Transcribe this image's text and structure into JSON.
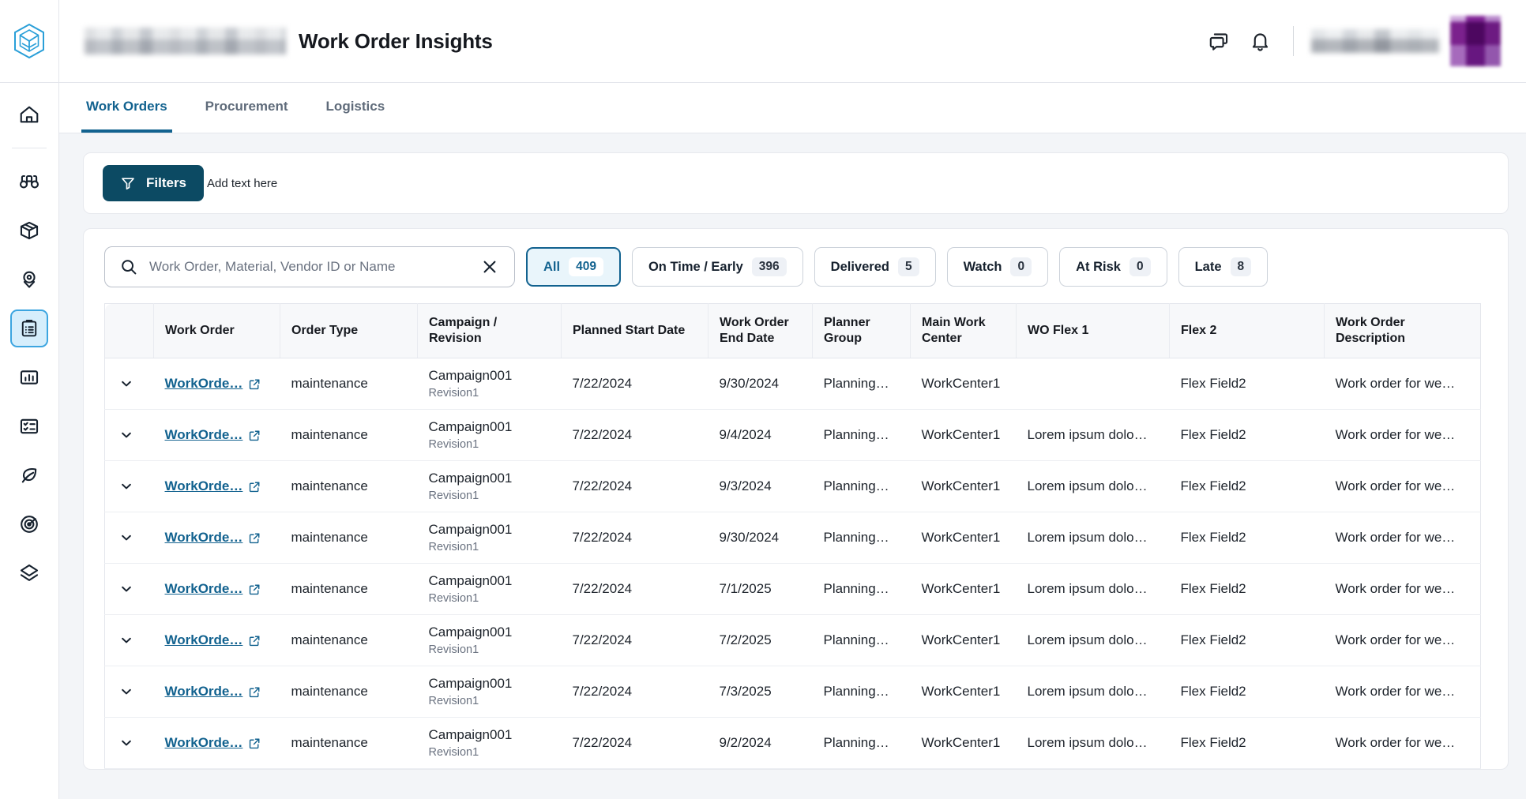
{
  "app": {
    "title": "Work Order Insights",
    "logo_icon": "hexagon-cube-logo",
    "org_name_redacted": "",
    "user_name_redacted": ""
  },
  "topbar": {
    "chat_icon": "chat-bubbles-icon",
    "notifications_icon": "bell-icon",
    "avatar_label": ""
  },
  "sidebar": {
    "items": [
      {
        "name": "home",
        "icon": "home-icon",
        "active": false
      },
      {
        "name": "discover",
        "icon": "binoculars-icon",
        "active": false
      },
      {
        "name": "inventory",
        "icon": "box-icon",
        "active": false
      },
      {
        "name": "locations",
        "icon": "map-pin-icon",
        "active": false
      },
      {
        "name": "work-orders",
        "icon": "clipboard-list-icon",
        "active": true
      },
      {
        "name": "analytics",
        "icon": "bar-chart-icon",
        "active": false
      },
      {
        "name": "tasks",
        "icon": "checklist-icon",
        "active": false
      },
      {
        "name": "sustainability",
        "icon": "leaf-icon",
        "active": false
      },
      {
        "name": "targets",
        "icon": "radar-target-icon",
        "active": false
      },
      {
        "name": "layers",
        "icon": "layers-diamond-icon",
        "active": false
      }
    ]
  },
  "tabs": [
    {
      "label": "Work Orders",
      "active": true
    },
    {
      "label": "Procurement",
      "active": false
    },
    {
      "label": "Logistics",
      "active": false
    }
  ],
  "filters": {
    "button_label": "Filters",
    "filter_icon": "funnel-icon",
    "hint_text": "Add text here"
  },
  "search": {
    "placeholder": "Work Order, Material, Vendor ID or Name",
    "value": "",
    "search_icon": "search-icon",
    "clear_icon": "close-x-icon"
  },
  "status_chips": [
    {
      "label": "All",
      "count": "409",
      "active": true
    },
    {
      "label": "On Time / Early",
      "count": "396",
      "active": false
    },
    {
      "label": "Delivered",
      "count": "5",
      "active": false
    },
    {
      "label": "Watch",
      "count": "0",
      "active": false
    },
    {
      "label": "At Risk",
      "count": "0",
      "active": false
    },
    {
      "label": "Late",
      "count": "8",
      "active": false
    }
  ],
  "table": {
    "columns": [
      "",
      "Work Order",
      "Order Type",
      "Campaign / Revision",
      "Planned Start Date",
      "Work Order End Date",
      "Planner Group",
      "Main Work Center",
      "WO Flex 1",
      "Flex 2",
      "Work Order Description"
    ],
    "expand_icon": "chevron-down-icon",
    "external_link_icon": "external-link-icon",
    "rows": [
      {
        "work_order": "WorkOrde…",
        "order_type": "maintenance",
        "campaign": "Campaign001",
        "revision": "Revision1",
        "planned_start": "7/22/2024",
        "end_date": "9/30/2024",
        "planner_group": "PlanningG…",
        "main_work_center": "WorkCenter1",
        "wo_flex_1": "",
        "flex_2": "Flex Field2",
        "description": "Work order for we…"
      },
      {
        "work_order": "WorkOrde…",
        "order_type": "maintenance",
        "campaign": "Campaign001",
        "revision": "Revision1",
        "planned_start": "7/22/2024",
        "end_date": "9/4/2024",
        "planner_group": "PlanningG…",
        "main_work_center": "WorkCenter1",
        "wo_flex_1": "Lorem ipsum dolo…",
        "flex_2": "Flex Field2",
        "description": "Work order for we…"
      },
      {
        "work_order": "WorkOrde…",
        "order_type": "maintenance",
        "campaign": "Campaign001",
        "revision": "Revision1",
        "planned_start": "7/22/2024",
        "end_date": "9/3/2024",
        "planner_group": "PlanningG…",
        "main_work_center": "WorkCenter1",
        "wo_flex_1": "Lorem ipsum dolo…",
        "flex_2": "Flex Field2",
        "description": "Work order for we…"
      },
      {
        "work_order": "WorkOrde…",
        "order_type": "maintenance",
        "campaign": "Campaign001",
        "revision": "Revision1",
        "planned_start": "7/22/2024",
        "end_date": "9/30/2024",
        "planner_group": "PlanningG…",
        "main_work_center": "WorkCenter1",
        "wo_flex_1": "Lorem ipsum dolo…",
        "flex_2": "Flex Field2",
        "description": "Work order for we…"
      },
      {
        "work_order": "WorkOrde…",
        "order_type": "maintenance",
        "campaign": "Campaign001",
        "revision": "Revision1",
        "planned_start": "7/22/2024",
        "end_date": "7/1/2025",
        "planner_group": "PlanningG…",
        "main_work_center": "WorkCenter1",
        "wo_flex_1": "Lorem ipsum dolo…",
        "flex_2": "Flex Field2",
        "description": "Work order for we…"
      },
      {
        "work_order": "WorkOrde…",
        "order_type": "maintenance",
        "campaign": "Campaign001",
        "revision": "Revision1",
        "planned_start": "7/22/2024",
        "end_date": "7/2/2025",
        "planner_group": "PlanningG…",
        "main_work_center": "WorkCenter1",
        "wo_flex_1": "Lorem ipsum dolo…",
        "flex_2": "Flex Field2",
        "description": "Work order for we…"
      },
      {
        "work_order": "WorkOrde…",
        "order_type": "maintenance",
        "campaign": "Campaign001",
        "revision": "Revision1",
        "planned_start": "7/22/2024",
        "end_date": "7/3/2025",
        "planner_group": "PlanningG…",
        "main_work_center": "WorkCenter1",
        "wo_flex_1": "Lorem ipsum dolo…",
        "flex_2": "Flex Field2",
        "description": "Work order for we…"
      },
      {
        "work_order": "WorkOrde…",
        "order_type": "maintenance",
        "campaign": "Campaign001",
        "revision": "Revision1",
        "planned_start": "7/22/2024",
        "end_date": "9/2/2024",
        "planner_group": "PlanningG…",
        "main_work_center": "WorkCenter1",
        "wo_flex_1": "Lorem ipsum dolo…",
        "flex_2": "Flex Field2",
        "description": "Work order for we…"
      }
    ]
  },
  "colors": {
    "accent": "#12628f",
    "filters_button": "#0c4a63",
    "active_rail": "#d6eefc",
    "page_bg": "#f3f5f8",
    "avatar": "#922fa0"
  }
}
